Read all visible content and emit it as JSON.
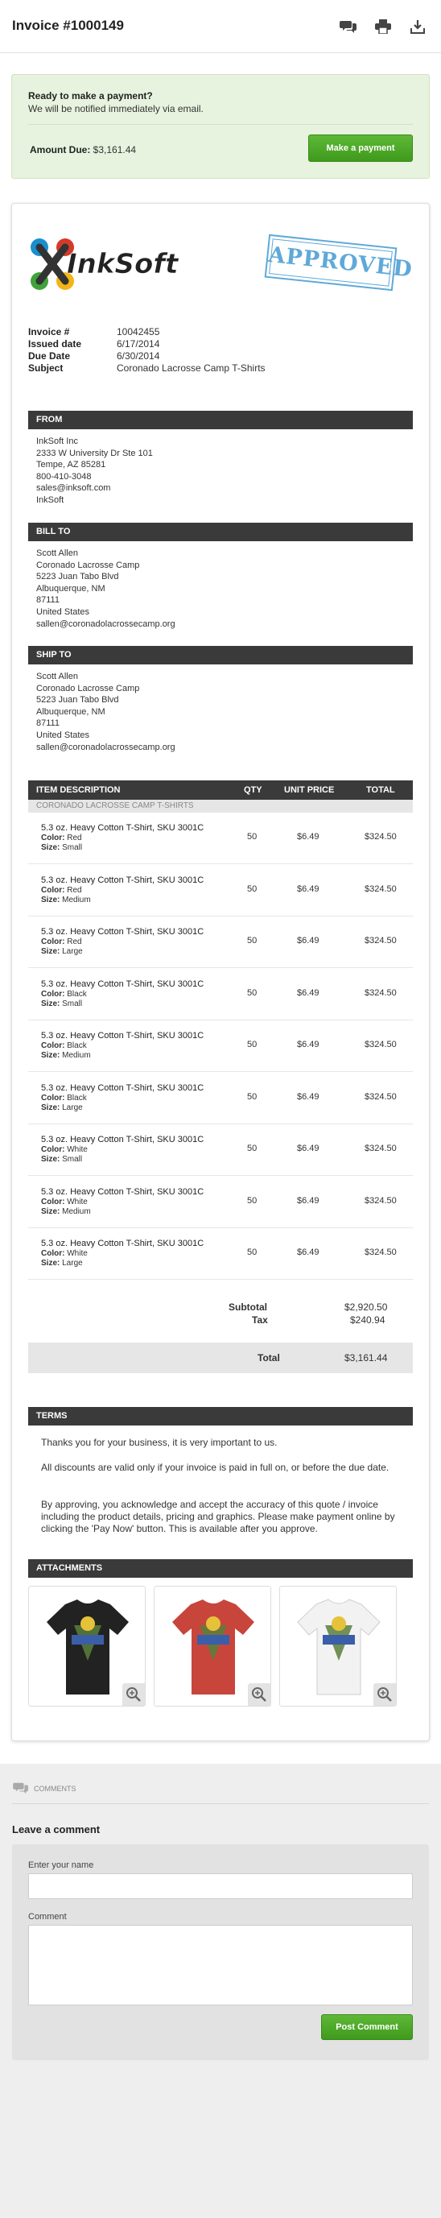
{
  "header": {
    "title": "Invoice #1000149",
    "icons": [
      "comments-icon",
      "print-icon",
      "download-icon"
    ]
  },
  "payment": {
    "title": "Ready to make a payment?",
    "subtitle": "We will be notified immediately via email.",
    "amount_label": "Amount Due:",
    "amount_value": "$3,161.44",
    "button_label": "Make a payment"
  },
  "stamp": "APPROVED",
  "logo_text": "InkSoft",
  "meta": [
    {
      "key": "Invoice #",
      "value": "10042455"
    },
    {
      "key": "Issued date",
      "value": "6/17/2014"
    },
    {
      "key": "Due Date",
      "value": "6/30/2014"
    },
    {
      "key": "Subject",
      "value": "Coronado Lacrosse Camp T-Shirts"
    }
  ],
  "from": {
    "heading": "FROM",
    "lines": [
      "InkSoft Inc",
      "2333 W University Dr Ste 101",
      "Tempe, AZ 85281",
      "800-410-3048",
      "sales@inksoft.com",
      "InkSoft"
    ]
  },
  "bill_to": {
    "heading": "BILL TO",
    "lines": [
      "Scott Allen",
      "Coronado Lacrosse Camp",
      "5223 Juan Tabo Blvd",
      "Albuquerque, NM",
      "87111",
      "United States",
      "sallen@coronadolacrossecamp.org"
    ]
  },
  "ship_to": {
    "heading": "SHIP TO",
    "lines": [
      "Scott Allen",
      "Coronado Lacrosse Camp",
      "5223 Juan Tabo Blvd",
      "Albuquerque, NM",
      "87111",
      "United States",
      "sallen@coronadolacrossecamp.org"
    ]
  },
  "table": {
    "headers": {
      "desc": "ITEM DESCRIPTION",
      "qty": "QTY",
      "price": "UNIT PRICE",
      "total": "TOTAL"
    },
    "category": "CORONADO LACROSSE CAMP T-SHIRTS",
    "items": [
      {
        "name": "5.3 oz. Heavy Cotton T-Shirt, SKU 3001C",
        "color": "Red",
        "size": "Small",
        "qty": "50",
        "price": "$6.49",
        "total": "$324.50"
      },
      {
        "name": "5.3 oz. Heavy Cotton T-Shirt, SKU 3001C",
        "color": "Red",
        "size": "Medium",
        "qty": "50",
        "price": "$6.49",
        "total": "$324.50"
      },
      {
        "name": "5.3 oz. Heavy Cotton T-Shirt, SKU 3001C",
        "color": "Red",
        "size": "Large",
        "qty": "50",
        "price": "$6.49",
        "total": "$324.50"
      },
      {
        "name": "5.3 oz. Heavy Cotton T-Shirt, SKU 3001C",
        "color": "Black",
        "size": "Small",
        "qty": "50",
        "price": "$6.49",
        "total": "$324.50"
      },
      {
        "name": "5.3 oz. Heavy Cotton T-Shirt, SKU 3001C",
        "color": "Black",
        "size": "Medium",
        "qty": "50",
        "price": "$6.49",
        "total": "$324.50"
      },
      {
        "name": "5.3 oz. Heavy Cotton T-Shirt, SKU 3001C",
        "color": "Black",
        "size": "Large",
        "qty": "50",
        "price": "$6.49",
        "total": "$324.50"
      },
      {
        "name": "5.3 oz. Heavy Cotton T-Shirt, SKU 3001C",
        "color": "White",
        "size": "Small",
        "qty": "50",
        "price": "$6.49",
        "total": "$324.50"
      },
      {
        "name": "5.3 oz. Heavy Cotton T-Shirt, SKU 3001C",
        "color": "White",
        "size": "Medium",
        "qty": "50",
        "price": "$6.49",
        "total": "$324.50"
      },
      {
        "name": "5.3 oz. Heavy Cotton T-Shirt, SKU 3001C",
        "color": "White",
        "size": "Large",
        "qty": "50",
        "price": "$6.49",
        "total": "$324.50"
      }
    ],
    "color_label": "Color:",
    "size_label": "Size:"
  },
  "totals": {
    "subtotal_label": "Subtotal",
    "subtotal": "$2,920.50",
    "tax_label": "Tax",
    "tax": "$240.94",
    "total_label": "Total",
    "total": "$3,161.44"
  },
  "terms": {
    "heading": "TERMS",
    "paragraphs": [
      "Thanks you for your business, it is very important to us.",
      "All discounts are valid only if your invoice is paid in full on, or before the due date.",
      "By approving, you acknowledge and accept the accuracy of this quote / invoice including the product details, pricing and graphics. Please make payment online by clicking the 'Pay Now' button. This is available after you approve."
    ]
  },
  "attachments": {
    "heading": "ATTACHMENTS",
    "shirts": [
      {
        "color": "#222222"
      },
      {
        "color": "#c8453c"
      },
      {
        "color": "#f2f2f2"
      }
    ]
  },
  "comments": {
    "label": "COMMENTS",
    "leave_title": "Leave a comment",
    "name_label": "Enter your name",
    "comment_label": "Comment",
    "post_button": "Post Comment"
  },
  "colors": {
    "accent_green": "#4fa82a",
    "dark_header": "#3a3a3a",
    "stamp_blue": "#5fa9d8"
  }
}
